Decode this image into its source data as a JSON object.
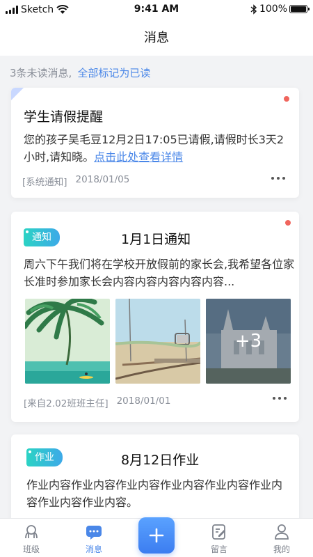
{
  "status_bar": {
    "carrier": "Sketch",
    "time": "9:41 AM",
    "battery": "100%"
  },
  "nav": {
    "title": "消息"
  },
  "unread": {
    "summary": "3条未读消息,",
    "mark_all_label": "全部标记为已读"
  },
  "messages": [
    {
      "type": "system",
      "title": "学生请假提醒",
      "body_text": "您的孩子吴毛豆12月2日17:05已请假,请假时长3天2小时,请知晓。",
      "link_label": "点击此处查看详情",
      "source": "[系统通知]",
      "date": "2018/01/05",
      "unread": true
    },
    {
      "type": "notice",
      "tag": "通知",
      "title": "1月1日通知",
      "body_text": "周六下午我们将在学校开放假前的家长会,我希望各位家长准时参加家长会内容内容内容内容内容...",
      "extra_images_label": "+3",
      "source": "[来自2.02班班主任]",
      "date": "2018/01/01",
      "unread": true
    },
    {
      "type": "homework",
      "tag": "作业",
      "title": "8月12日作业",
      "body_text": "作业内容作业内容作业内容作业内容作业内容作业内容作业内容作业内容。"
    }
  ],
  "tabs": [
    {
      "label": "班级",
      "icon": "class-icon",
      "active": false
    },
    {
      "label": "消息",
      "icon": "message-icon",
      "active": true
    },
    {
      "label": "",
      "icon": "plus-icon",
      "active": false
    },
    {
      "label": "留言",
      "icon": "edit-note-icon",
      "active": false
    },
    {
      "label": "我的",
      "icon": "person-icon",
      "active": false
    }
  ],
  "colors": {
    "accent": "#4a87e8",
    "unread_dot": "#f0655d",
    "tag_gradient_start": "#2bd3c4",
    "tag_gradient_end": "#3da9e8"
  }
}
